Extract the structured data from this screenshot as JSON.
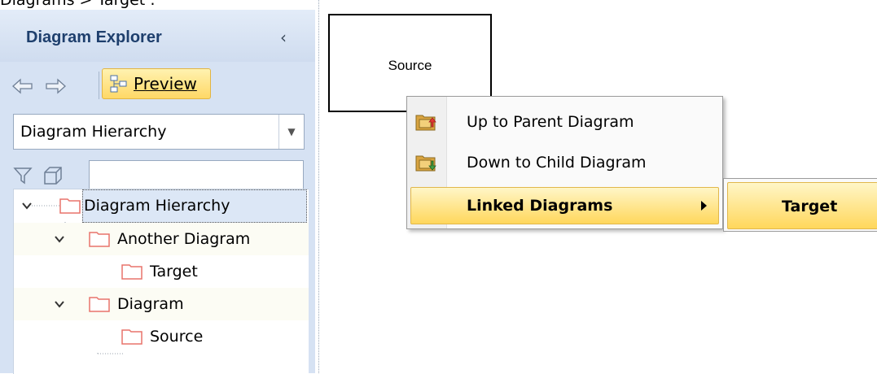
{
  "breadcrumb": "Diagrams > Target :",
  "explorer": {
    "title": "Diagram Explorer",
    "collapse_glyph": "‹",
    "toolbar": {
      "back_icon": "back-arrow-icon",
      "forward_icon": "forward-arrow-icon",
      "preview_label": "Preview",
      "preview_icon": "preview-diagram-icon"
    },
    "view_selector": {
      "value": "Diagram Hierarchy"
    },
    "filter": {
      "filter_icon": "filter-icon",
      "scope_icon": "box-icon",
      "search_value": ""
    },
    "tree": [
      {
        "label": "Diagram Hierarchy",
        "level": 0,
        "expanded": true,
        "selected": true
      },
      {
        "label": "Another Diagram",
        "level": 1,
        "expanded": true,
        "selected": false
      },
      {
        "label": "Target",
        "level": 2,
        "expanded": false,
        "selected": false
      },
      {
        "label": "Diagram",
        "level": 1,
        "expanded": true,
        "selected": false
      },
      {
        "label": "Source",
        "level": 2,
        "expanded": false,
        "selected": false
      }
    ]
  },
  "canvas": {
    "element_label": "Source"
  },
  "context_menu": {
    "items": [
      {
        "label": "Up to Parent Diagram",
        "icon": "up-to-parent-diagram-icon"
      },
      {
        "label": "Down to Child Diagram",
        "icon": "down-to-child-diagram-icon"
      },
      {
        "label": "Linked Diagrams",
        "has_submenu": true,
        "active": true
      }
    ],
    "submenu": [
      {
        "label": "Target",
        "active": true
      }
    ]
  },
  "colors": {
    "panel_background": "#d6e2f3",
    "title_text": "#1e3f6d",
    "highlight_top": "#fff6c7",
    "highlight_bottom": "#ffd75c",
    "folder_outline": "#e8736b"
  }
}
